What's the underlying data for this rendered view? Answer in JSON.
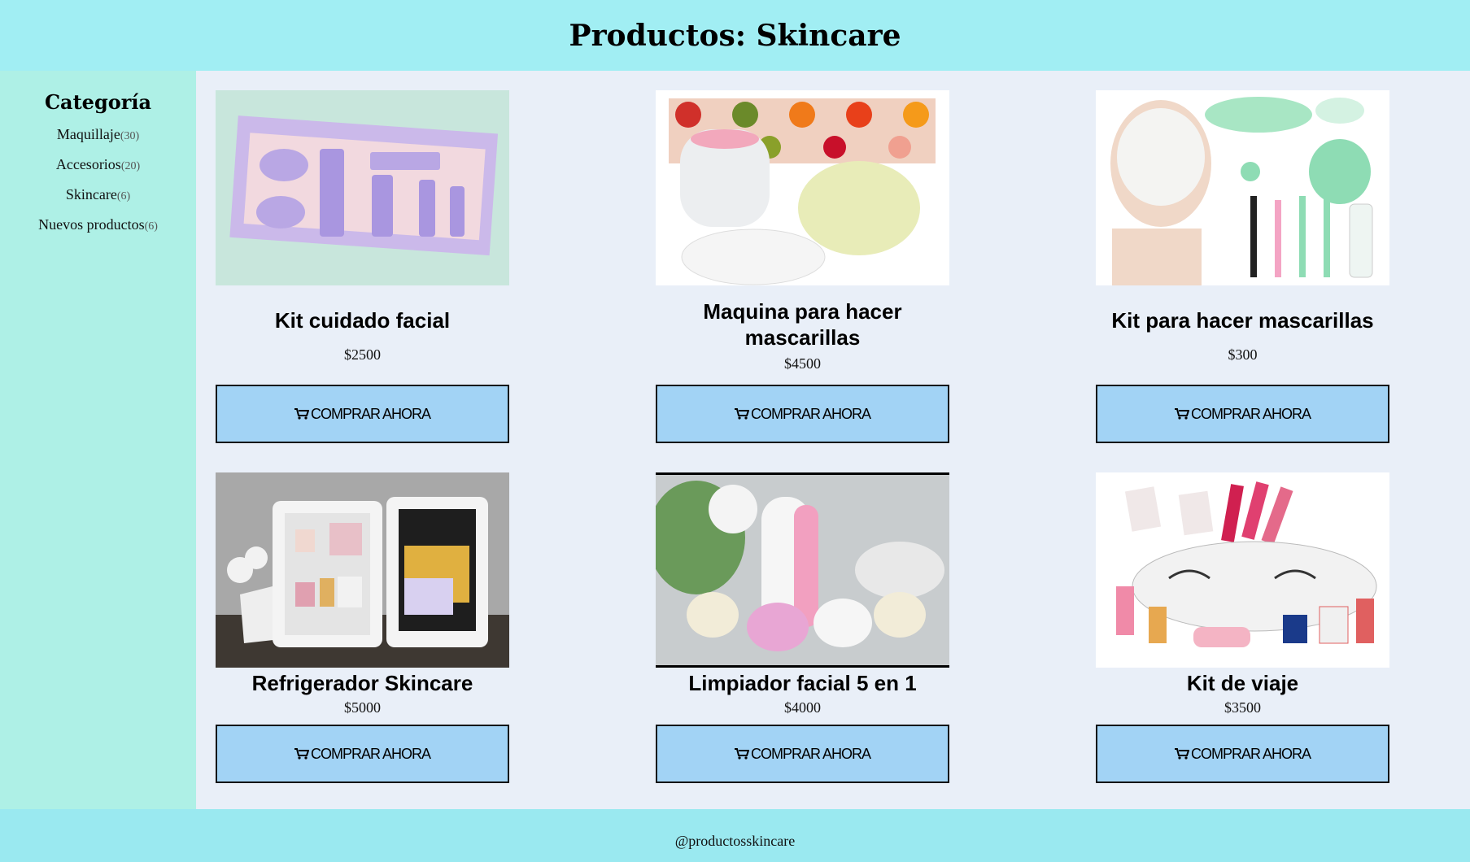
{
  "header": {
    "title": "Productos: Skincare"
  },
  "sidebar": {
    "heading": "Categoría",
    "items": [
      {
        "label": "Maquillaje",
        "count": "(30)"
      },
      {
        "label": "Accesorios",
        "count": "(20)"
      },
      {
        "label": "Skincare",
        "count": "(6)"
      },
      {
        "label": "Nuevos productos",
        "count": "(6)"
      }
    ]
  },
  "products": [
    {
      "title": "Kit cuidado facial",
      "price": "$2500",
      "button": "COMPRAR AHORA"
    },
    {
      "title": "Maquina para hacer mascarillas",
      "price": "$4500",
      "button": "COMPRAR AHORA"
    },
    {
      "title": "Kit para hacer mascarillas",
      "price": "$300",
      "button": "COMPRAR AHORA"
    },
    {
      "title": "Refrigerador Skincare",
      "price": "$5000",
      "button": "COMPRAR AHORA"
    },
    {
      "title": "Limpiador facial 5 en 1",
      "price": "$4000",
      "button": "COMPRAR AHORA"
    },
    {
      "title": "Kit de viaje",
      "price": "$3500",
      "button": "COMPRAR AHORA"
    }
  ],
  "footer": {
    "handle": "@productosskincare"
  },
  "colors": {
    "header_bg": "#a1eef3",
    "sidebar_bg": "#aef0e6",
    "main_bg": "#e9eff8",
    "button_bg": "#a2d3f5",
    "footer_bg": "#9ae9f0"
  },
  "icons": {
    "button_icon": "cart-icon"
  }
}
